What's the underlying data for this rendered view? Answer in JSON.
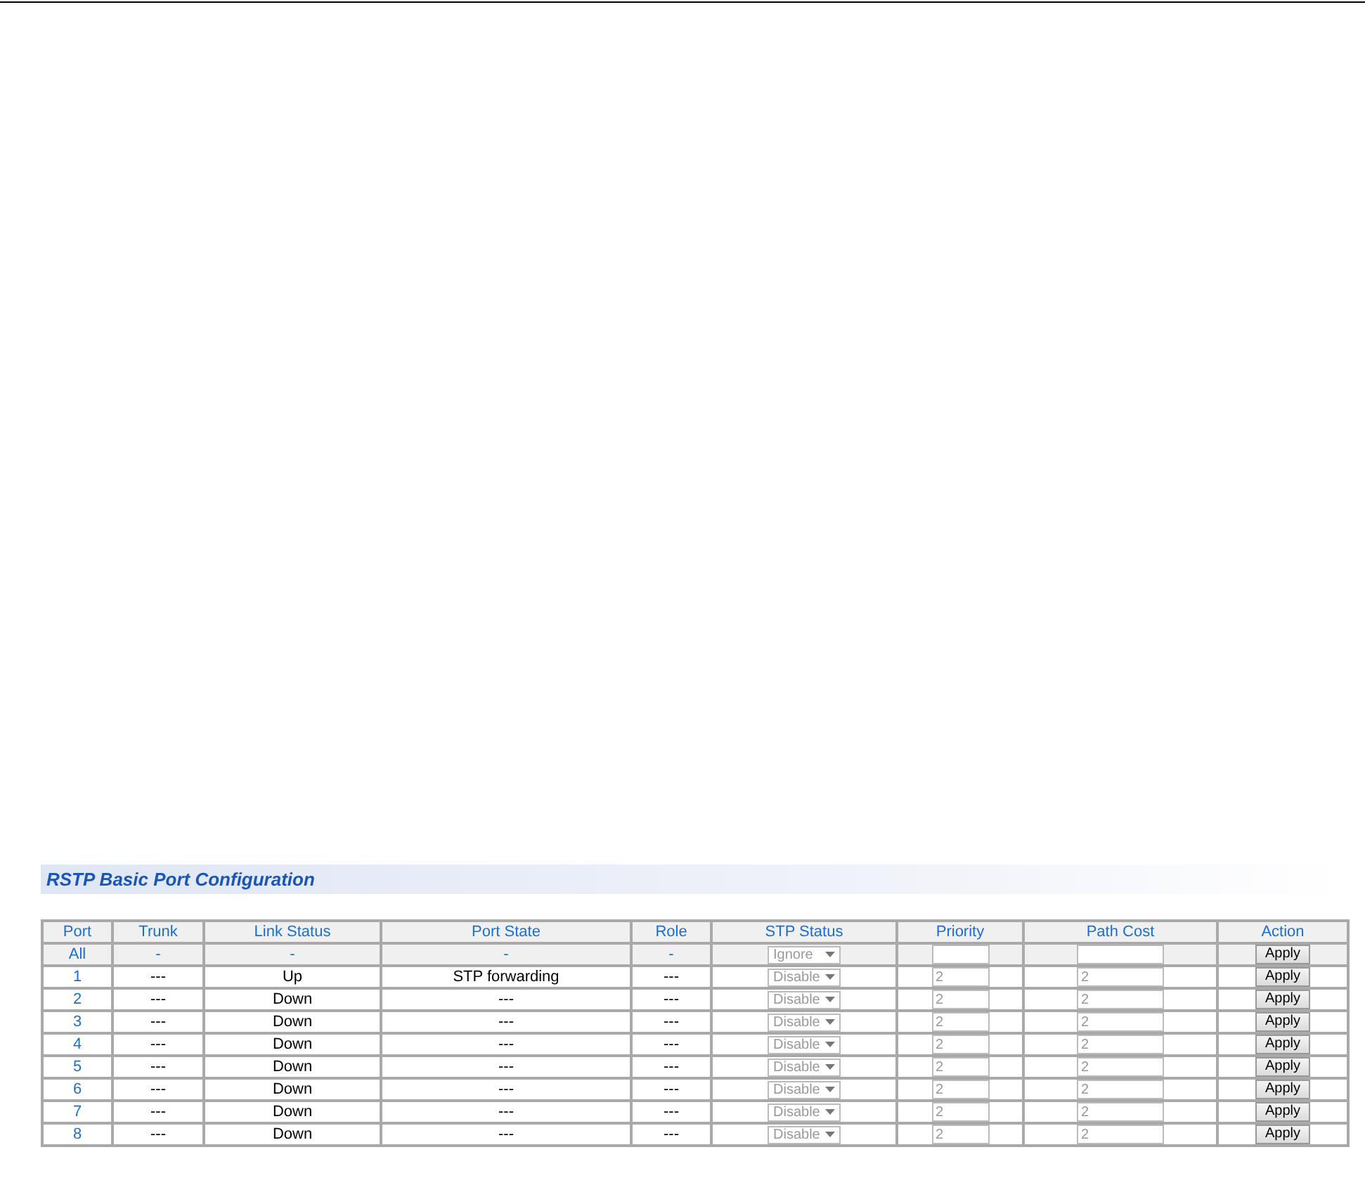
{
  "section_title": "RSTP Basic Port Configuration",
  "table": {
    "columns": [
      "Port",
      "Trunk",
      "Link Status",
      "Port State",
      "Role",
      "STP Status",
      "Priority",
      "Path Cost",
      "Action"
    ],
    "all_row": {
      "port": "All",
      "trunk": "-",
      "link_status": "-",
      "port_state": "-",
      "role": "-",
      "stp_status": "Ignore",
      "action": "Apply"
    },
    "rows": [
      {
        "port": "1",
        "trunk": "---",
        "link_status": "Up",
        "port_state": "STP forwarding",
        "role": "---",
        "stp_status": "Disable",
        "priority": "2",
        "path_cost": "2",
        "action": "Apply"
      },
      {
        "port": "2",
        "trunk": "---",
        "link_status": "Down",
        "port_state": "---",
        "role": "---",
        "stp_status": "Disable",
        "priority": "2",
        "path_cost": "2",
        "action": "Apply"
      },
      {
        "port": "3",
        "trunk": "---",
        "link_status": "Down",
        "port_state": "---",
        "role": "---",
        "stp_status": "Disable",
        "priority": "2",
        "path_cost": "2",
        "action": "Apply"
      },
      {
        "port": "4",
        "trunk": "---",
        "link_status": "Down",
        "port_state": "---",
        "role": "---",
        "stp_status": "Disable",
        "priority": "2",
        "path_cost": "2",
        "action": "Apply"
      },
      {
        "port": "5",
        "trunk": "---",
        "link_status": "Down",
        "port_state": "---",
        "role": "---",
        "stp_status": "Disable",
        "priority": "2",
        "path_cost": "2",
        "action": "Apply"
      },
      {
        "port": "6",
        "trunk": "---",
        "link_status": "Down",
        "port_state": "---",
        "role": "---",
        "stp_status": "Disable",
        "priority": "2",
        "path_cost": "2",
        "action": "Apply"
      },
      {
        "port": "7",
        "trunk": "---",
        "link_status": "Down",
        "port_state": "---",
        "role": "---",
        "stp_status": "Disable",
        "priority": "2",
        "path_cost": "2",
        "action": "Apply"
      },
      {
        "port": "8",
        "trunk": "---",
        "link_status": "Down",
        "port_state": "---",
        "role": "---",
        "stp_status": "Disable",
        "priority": "2",
        "path_cost": "2",
        "action": "Apply"
      }
    ]
  }
}
